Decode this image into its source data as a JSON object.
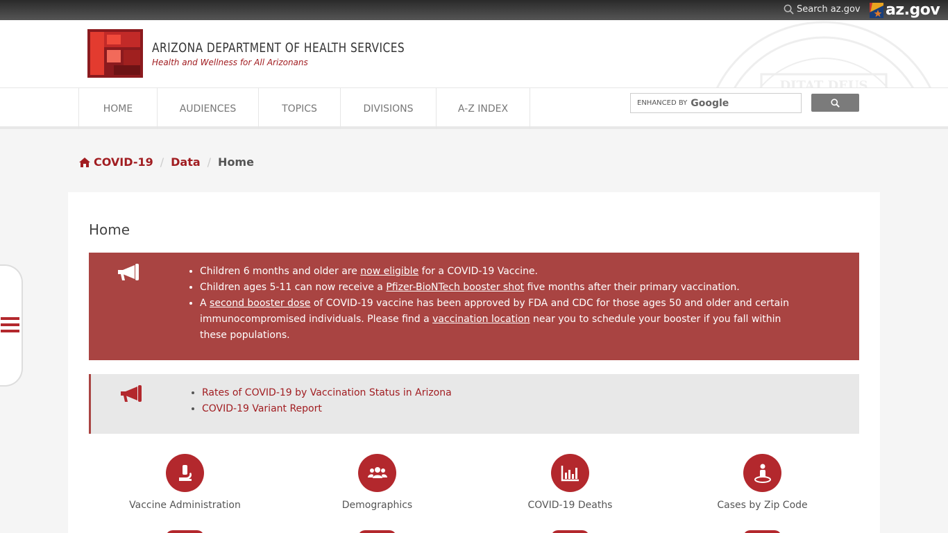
{
  "topbar": {
    "search_label": "Search az.gov",
    "brand": "az.gov"
  },
  "header": {
    "agency_name": "ARIZONA DEPARTMENT OF HEALTH SERVICES",
    "tagline": "Health and Wellness for All Arizonans",
    "seal_text": "DITAT DEUS"
  },
  "nav": {
    "items": [
      {
        "label": "HOME"
      },
      {
        "label": "AUDIENCES"
      },
      {
        "label": "TOPICS"
      },
      {
        "label": "DIVISIONS"
      },
      {
        "label": "A-Z INDEX"
      }
    ],
    "search_prefix": "ENHANCED BY",
    "search_brand": "Google"
  },
  "breadcrumb": {
    "items": [
      "COVID-19",
      "Data"
    ],
    "current": "Home"
  },
  "main": {
    "title": "Home",
    "alert1": {
      "b1_pre": "Children 6 months and older are ",
      "b1_link": "now eligible",
      "b1_post": " for a COVID-19 Vaccine.",
      "b2_pre": "Children ages 5-11 can now receive a ",
      "b2_link": "Pfizer-BioNTech booster shot",
      "b2_post": " five months after their primary vaccination.",
      "b3_pre": "A ",
      "b3_link1": "second booster dose",
      "b3_mid": " of COVID-19 vaccine has been approved by FDA and CDC for those ages 50 and older and certain immunocompromised individuals. Please find a ",
      "b3_link2": "vaccination location",
      "b3_post": " near you to schedule your booster if you fall within these populations."
    },
    "alert2": {
      "links": [
        "Rates of COVID-19 by Vaccination Status in Arizona",
        "COVID-19 Variant Report"
      ]
    },
    "tiles": [
      {
        "label": "Vaccine Administration",
        "icon": "microscope-icon"
      },
      {
        "label": "Demographics",
        "icon": "users-icon"
      },
      {
        "label": "COVID-19 Deaths",
        "icon": "bar-chart-icon"
      },
      {
        "label": "Cases by Zip Code",
        "icon": "person-location-icon"
      }
    ]
  },
  "colors": {
    "brand_red": "#a11d21",
    "alert_red": "#a94442",
    "tile_red": "#b3282d"
  }
}
